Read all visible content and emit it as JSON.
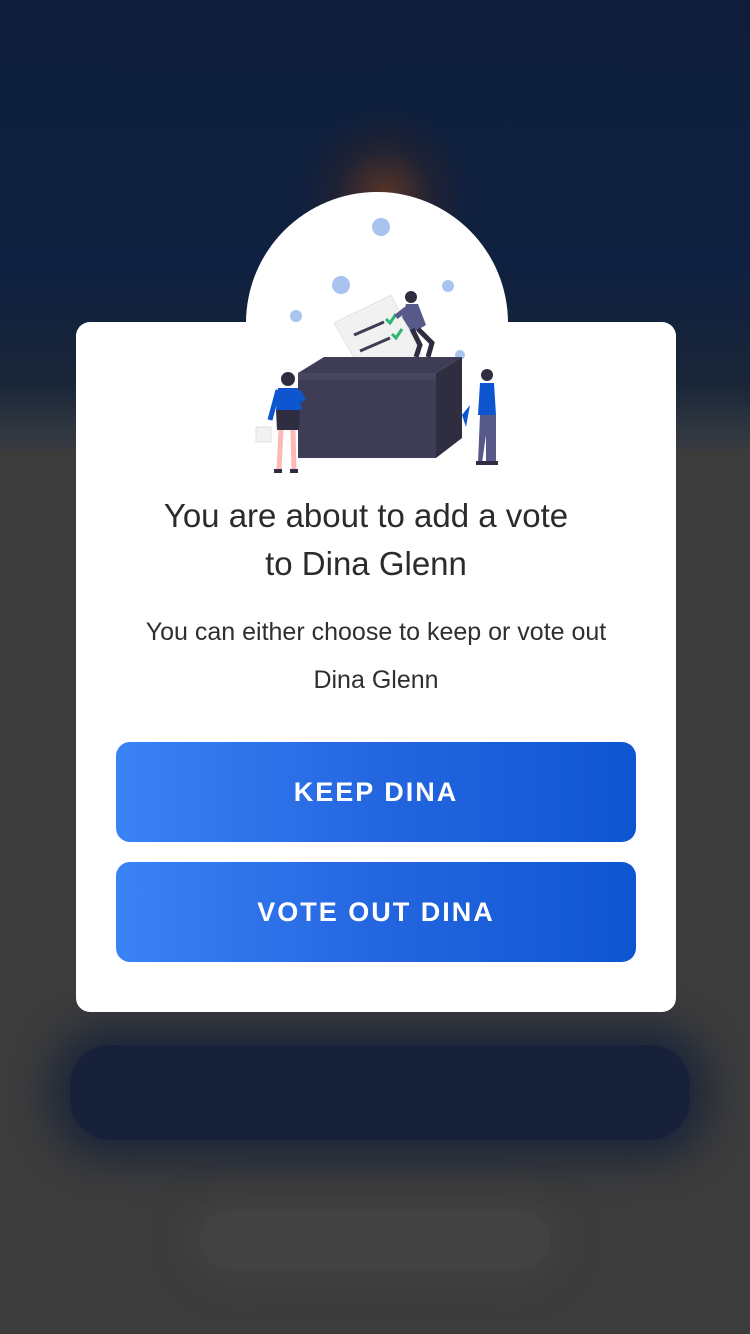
{
  "dialog": {
    "title_line1": "You are about to add a vote",
    "title_line2": "to Dina Glenn",
    "subtitle_line1": "You can either choose to keep or vote out",
    "subtitle_line2": "Dina Glenn",
    "illustration_icon": "ballot-box-voting-illustration"
  },
  "buttons": {
    "keep_label": "KEEP DINA",
    "vote_out_label": "VOTE OUT DINA"
  },
  "colors": {
    "accent_start": "#3b82f5",
    "accent_end": "#0f55d2",
    "overlay_background": "#3c3c3c",
    "card_background": "#ffffff",
    "header_background": "#0e1e3a"
  }
}
